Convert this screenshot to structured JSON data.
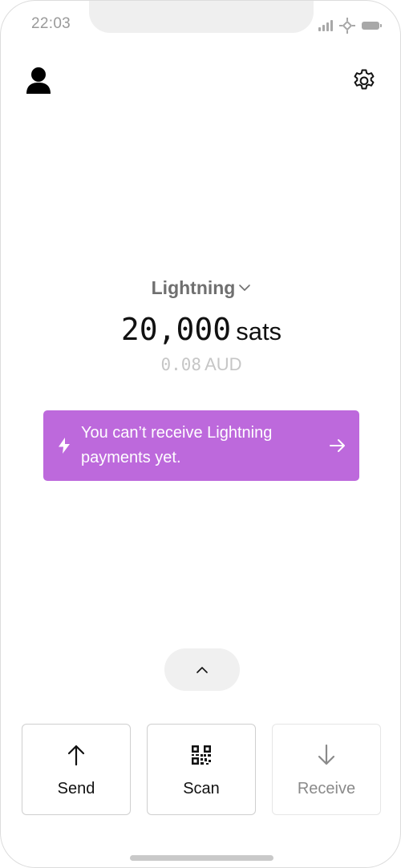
{
  "status_bar": {
    "time": "22:03"
  },
  "header": {
    "profile_icon": "person-icon",
    "settings_icon": "gear-icon"
  },
  "balance": {
    "wallet_label": "Lightning",
    "amount": "20,000",
    "unit": "sats",
    "fiat_amount": "0.08",
    "fiat_unit": "AUD"
  },
  "banner": {
    "text": "You can’t receive Lightning payments yet.",
    "icon": "lightning-bolt-icon",
    "action_icon": "arrow-right-icon",
    "color": "#bd69dc"
  },
  "expand": {
    "icon": "chevron-up-icon"
  },
  "actions": {
    "send_label": "Send",
    "scan_label": "Scan",
    "receive_label": "Receive",
    "receive_disabled": true
  },
  "colors": {
    "accent": "#bd69dc",
    "muted_text": "#6f6f6f",
    "fiat_text": "#c6c6c6"
  }
}
